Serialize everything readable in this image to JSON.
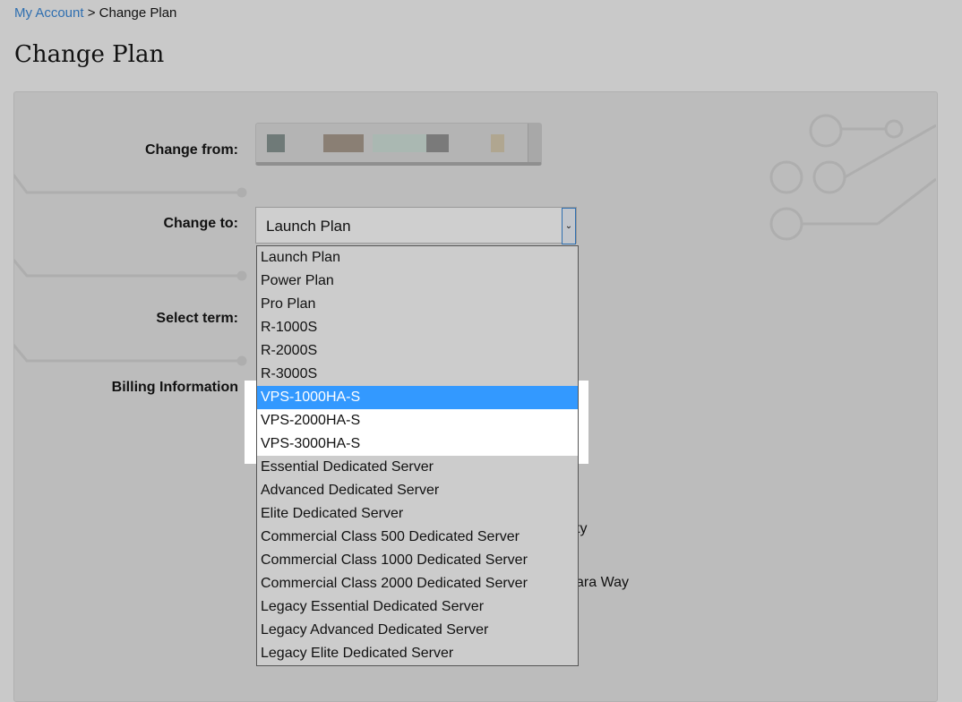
{
  "breadcrumb": {
    "link": "My Account",
    "separator": " > ",
    "current": "Change Plan"
  },
  "page_title": "Change Plan",
  "form": {
    "change_from_label": "Change from:",
    "change_to_label": "Change to:",
    "select_term_label": "Select term:",
    "billing_label": "Billing Information",
    "change_to_value": "Launch Plan",
    "options": [
      "Launch Plan",
      "Power Plan",
      "Pro Plan",
      "R-1000S",
      "R-2000S",
      "R-3000S",
      "VPS-1000HA-S",
      "VPS-2000HA-S",
      "VPS-3000HA-S",
      "Essential Dedicated Server",
      "Advanced Dedicated Server",
      "Elite Dedicated Server",
      "Commercial Class 500 Dedicated Server",
      "Commercial Class 1000 Dedicated Server",
      "Commercial Class 2000 Dedicated Server",
      "Legacy Essential Dedicated Server",
      "Legacy Advanced Dedicated Server",
      "Legacy Elite Dedicated Server"
    ],
    "highlighted_option": "VPS-1000HA-S",
    "hidden_fragments": [
      "ty",
      "ara Way"
    ]
  },
  "colors": {
    "link": "#2f6fb0",
    "selection": "#3399ff"
  }
}
